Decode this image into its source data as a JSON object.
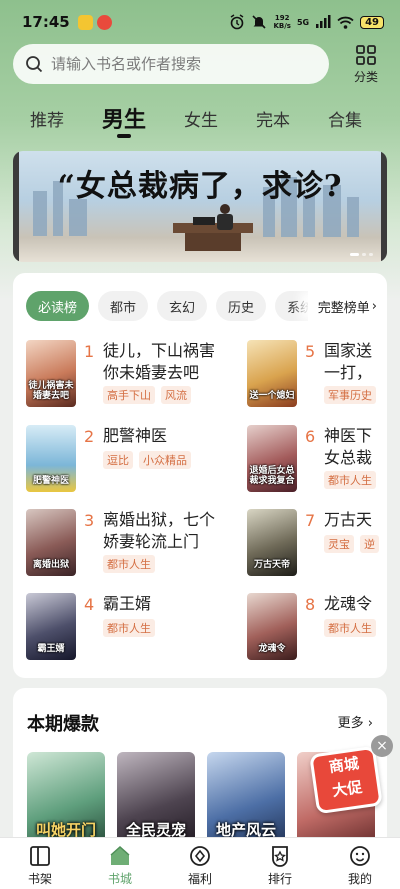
{
  "status_bar": {
    "time": "17:45",
    "net_speed_value": "192",
    "net_speed_unit": "KB/s",
    "network": "5G",
    "battery": "49"
  },
  "search": {
    "placeholder": "请输入书名或作者搜索",
    "category_label": "分类"
  },
  "top_tabs": [
    {
      "label": "推荐"
    },
    {
      "label": "男生",
      "active": true
    },
    {
      "label": "女生"
    },
    {
      "label": "完本"
    },
    {
      "label": "合集"
    }
  ],
  "banner": {
    "title": "“女总裁病了，求诊?"
  },
  "rank": {
    "chips": [
      "必读榜",
      "都市",
      "玄幻",
      "历史",
      "系统"
    ],
    "full_rank_label": "完整榜单",
    "books": [
      {
        "rank": "1",
        "title_line1": "徒儿，下山祸害",
        "title_line2": "你未婚妻去吧",
        "tags": [
          "高手下山",
          "风流"
        ],
        "cover_text": "徒儿祸害未婚妻去吧"
      },
      {
        "rank": "2",
        "title_line1": "肥警神医",
        "title_line2": "",
        "tags": [
          "逗比",
          "小众精品"
        ],
        "cover_text": "肥警神医"
      },
      {
        "rank": "3",
        "title_line1": "离婚出狱，七个",
        "title_line2": "娇妻轮流上门",
        "tags": [
          "都市人生"
        ],
        "cover_text": "离婚出狱"
      },
      {
        "rank": "4",
        "title_line1": "霸王婿",
        "title_line2": "",
        "tags": [
          "都市人生"
        ],
        "cover_text": "霸王婿"
      },
      {
        "rank": "5",
        "title_line1": "国家送",
        "title_line2": "一打，",
        "tags": [
          "军事历史"
        ],
        "cover_text": "送一个媳妇"
      },
      {
        "rank": "6",
        "title_line1": "神医下",
        "title_line2": "女总裁",
        "tags": [
          "都市人生"
        ],
        "cover_text": "退婚后女总裁求我复合"
      },
      {
        "rank": "7",
        "title_line1": "万古天",
        "title_line2": "",
        "tags": [
          "灵宝",
          "逆"
        ],
        "cover_text": "万古天帝"
      },
      {
        "rank": "8",
        "title_line1": "龙魂令",
        "title_line2": "",
        "tags": [
          "都市人生"
        ],
        "cover_text": "龙魂令"
      }
    ]
  },
  "hot": {
    "title": "本期爆款",
    "more_label": "更多",
    "covers": [
      {
        "text": "叫她开门"
      },
      {
        "text": "全民灵宠"
      },
      {
        "text": "地产风云"
      },
      {
        "text": ""
      }
    ]
  },
  "promo": {
    "line1": "商城",
    "line2": "大促"
  },
  "bottom_nav": [
    {
      "label": "书架"
    },
    {
      "label": "书城",
      "active": true
    },
    {
      "label": "福利"
    },
    {
      "label": "排行"
    },
    {
      "label": "我的"
    }
  ],
  "colors": {
    "accent": "#5fa36b",
    "rank_number": "#e67446",
    "tag_text": "#d46f43",
    "promo": "#e8483a"
  }
}
